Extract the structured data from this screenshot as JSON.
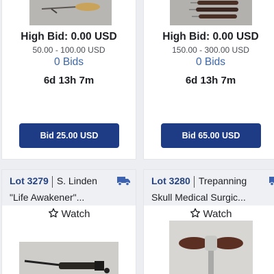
{
  "cards": [
    {
      "high_bid": "High Bid: 0.00 USD",
      "estimate": "50.00 - 100.00 USD",
      "bids": "0 Bids",
      "time_left": "6d 13h 7m",
      "bid_button": "Bid 25.00 USD"
    },
    {
      "high_bid": "High Bid: 0.00 USD",
      "estimate": "150.00 - 300.00 USD",
      "bids": "0 Bids",
      "time_left": "6d 13h 7m",
      "bid_button": "Bid 65.00 USD"
    },
    {
      "lot": "Lot 3279",
      "seller": "S. Linden",
      "title": "\"Life Awakener\"...",
      "watch": "Watch"
    },
    {
      "lot": "Lot 3280",
      "seller": "Trepanning",
      "title": "Skull Medical Surgic...",
      "watch": "Watch"
    }
  ],
  "colors": {
    "accent_button": "#1e3b86",
    "bids_link": "#3b66a8",
    "lot_number": "#26437f",
    "shipping_icon": "#3d63b0"
  },
  "icons": [
    "shipping-truck-icon",
    "star-outline-icon"
  ]
}
